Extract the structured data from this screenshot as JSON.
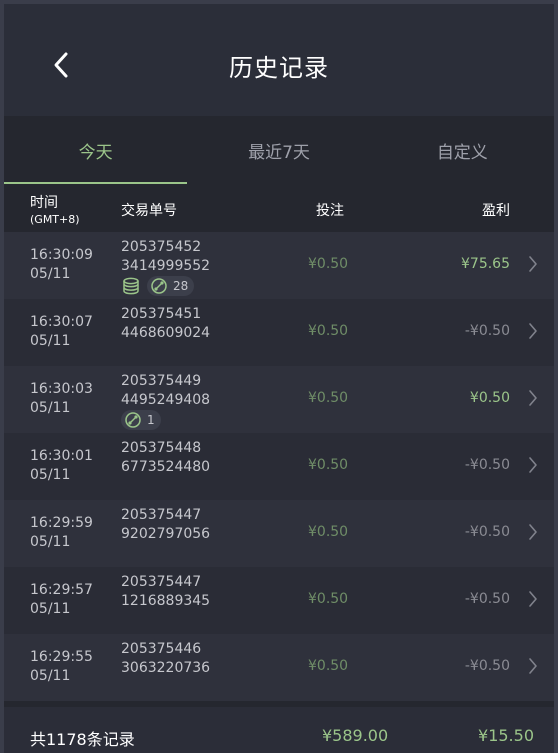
{
  "header": {
    "title": "历史记录"
  },
  "tabs": [
    {
      "label": "今天",
      "active": true
    },
    {
      "label": "最近7天",
      "active": false
    },
    {
      "label": "自定义",
      "active": false
    }
  ],
  "columns": {
    "time": "时间",
    "timezone": "(GMT+8)",
    "id": "交易单号",
    "bet": "投注",
    "profit": "盈利"
  },
  "rows": [
    {
      "time": "16:30:09",
      "date": "05/11",
      "id1": "205375452",
      "id2": "3414999552",
      "bet": "¥0.50",
      "profit": "¥75.65",
      "win": true,
      "coin_badge": true,
      "link_count": "28"
    },
    {
      "time": "16:30:07",
      "date": "05/11",
      "id1": "205375451",
      "id2": "4468609024",
      "bet": "¥0.50",
      "profit": "-¥0.50",
      "win": false
    },
    {
      "time": "16:30:03",
      "date": "05/11",
      "id1": "205375449",
      "id2": "4495249408",
      "bet": "¥0.50",
      "profit": "¥0.50",
      "win": true,
      "link_count": "1"
    },
    {
      "time": "16:30:01",
      "date": "05/11",
      "id1": "205375448",
      "id2": "6773524480",
      "bet": "¥0.50",
      "profit": "-¥0.50",
      "win": false
    },
    {
      "time": "16:29:59",
      "date": "05/11",
      "id1": "205375447",
      "id2": "9202797056",
      "bet": "¥0.50",
      "profit": "-¥0.50",
      "win": false
    },
    {
      "time": "16:29:57",
      "date": "05/11",
      "id1": "205375447",
      "id2": "1216889345",
      "bet": "¥0.50",
      "profit": "-¥0.50",
      "win": false
    },
    {
      "time": "16:29:55",
      "date": "05/11",
      "id1": "205375446",
      "id2": "3063220736",
      "bet": "¥0.50",
      "profit": "-¥0.50",
      "win": false
    }
  ],
  "footer": {
    "count": "共1178条记录",
    "bet_total": "¥589.00",
    "profit_total": "¥15.50"
  },
  "colors": {
    "accent": "#9bc58a",
    "background": "#25272f"
  },
  "icons": {
    "back": "chevron-left-icon",
    "row": "chevron-right-icon",
    "coin": "coin-stack-icon",
    "link": "link-icon"
  }
}
